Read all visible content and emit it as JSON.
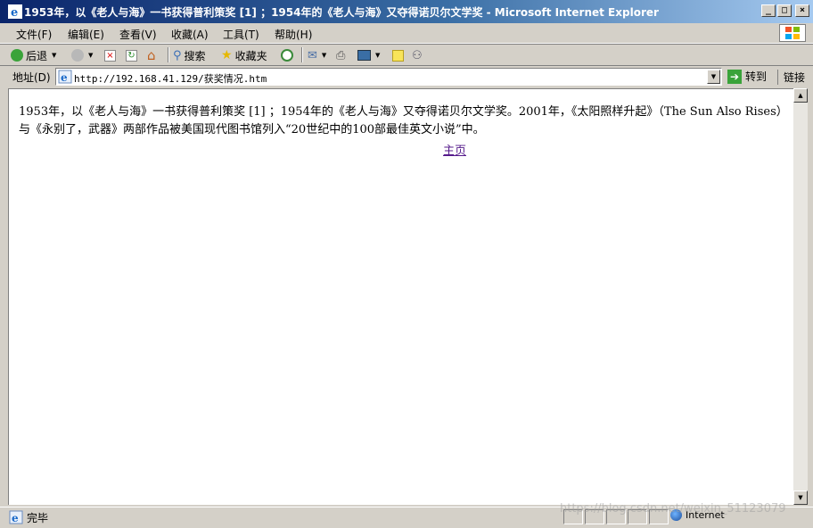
{
  "window": {
    "title": "1953年，以《老人与海》一书获得普利策奖 [1] ；1954年的《老人与海》又夺得诺贝尔文学奖 - Microsoft Internet Explorer"
  },
  "menu": {
    "items": [
      "文件(F)",
      "编辑(E)",
      "查看(V)",
      "收藏(A)",
      "工具(T)",
      "帮助(H)"
    ]
  },
  "toolbar": {
    "back_label": "后退",
    "search_label": "搜索",
    "favorites_label": "收藏夹"
  },
  "address": {
    "label": "地址(D)",
    "url": "http://192.168.41.129/获奖情况.htm",
    "go_label": "转到",
    "links_label": "链接"
  },
  "page": {
    "paragraph": "1953年，以《老人与海》一书获得普利策奖 [1] ；1954年的《老人与海》又夺得诺贝尔文学奖。2001年，《太阳照样升起》（The Sun Also Rises）与《永别了，武器》两部作品被美国现代图书馆列入“20世纪中的100部最佳英文小说”中。",
    "home_link": "主页"
  },
  "status": {
    "text": "完毕",
    "zone": "Internet",
    "watermark": "https://blog.csdn.net/weixin_51123079"
  },
  "colors": {
    "title_active": "#0a246a",
    "chrome": "#d4d0c8",
    "visited_link": "#551a8b"
  }
}
